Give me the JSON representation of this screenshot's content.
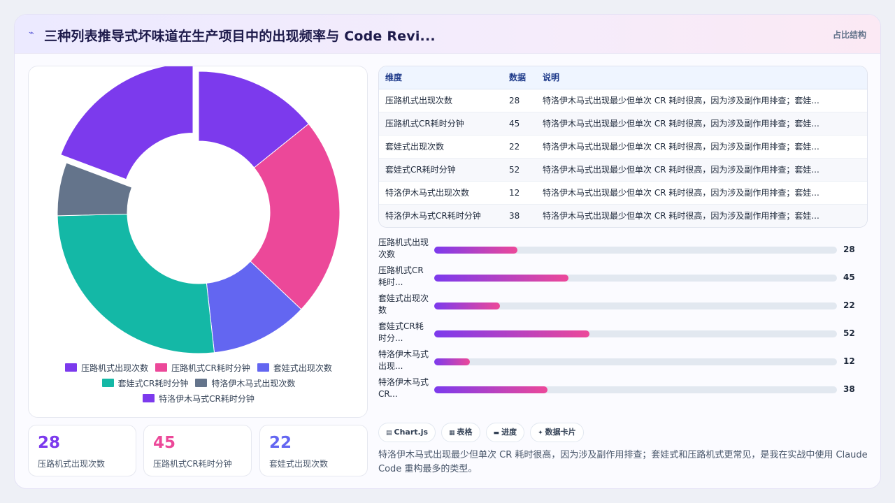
{
  "header": {
    "spark_icon": "sparkle-icon",
    "title": "三种列表推导式坏味道在生产项目中的出现频率与 Code Revi...",
    "tag": "占比结构"
  },
  "colors": {
    "palette": [
      "#7c3aed",
      "#ec4899",
      "#6366f1",
      "#14b8a6",
      "#64748b",
      "#7c3aed"
    ],
    "stat_colors": [
      "#7c3aed",
      "#ec4899",
      "#6366f1"
    ]
  },
  "chart_data": {
    "type": "pie",
    "variant": "doughnut",
    "categories": [
      "压路机式出现次数",
      "压路机式CR耗时分钟",
      "套娃式出现次数",
      "套娃式CR耗时分钟",
      "特洛伊木马式出现次数",
      "特洛伊木马式CR耗时分钟"
    ],
    "values": [
      28,
      45,
      22,
      52,
      12,
      38
    ],
    "exploded": "特洛伊木马式CR耗时分钟",
    "legend_position": "bottom"
  },
  "legend": [
    {
      "label": "压路机式出现次数",
      "color": "#7c3aed"
    },
    {
      "label": "压路机式CR耗时分钟",
      "color": "#ec4899"
    },
    {
      "label": "套娃式出现次数",
      "color": "#6366f1"
    },
    {
      "label": "套娃式CR耗时分钟",
      "color": "#14b8a6"
    },
    {
      "label": "特洛伊木马式出现次数",
      "color": "#64748b"
    },
    {
      "label": "特洛伊木马式CR耗时分钟",
      "color": "#7c3aed"
    }
  ],
  "stats": [
    {
      "value": "28",
      "label": "压路机式出现次数"
    },
    {
      "value": "45",
      "label": "压路机式CR耗时分钟"
    },
    {
      "value": "22",
      "label": "套娃式出现次数"
    }
  ],
  "table": {
    "headers": [
      "维度",
      "数据",
      "说明"
    ],
    "rows": [
      [
        "压路机式出现次数",
        "28",
        "特洛伊木马式出现最少但单次 CR 耗时很高，因为涉及副作用排查；套娃..."
      ],
      [
        "压路机式CR耗时分钟",
        "45",
        "特洛伊木马式出现最少但单次 CR 耗时很高，因为涉及副作用排查；套娃..."
      ],
      [
        "套娃式出现次数",
        "22",
        "特洛伊木马式出现最少但单次 CR 耗时很高，因为涉及副作用排查；套娃..."
      ],
      [
        "套娃式CR耗时分钟",
        "52",
        "特洛伊木马式出现最少但单次 CR 耗时很高，因为涉及副作用排查；套娃..."
      ],
      [
        "特洛伊木马式出现次数",
        "12",
        "特洛伊木马式出现最少但单次 CR 耗时很高，因为涉及副作用排查；套娃..."
      ],
      [
        "特洛伊木马式CR耗时分钟",
        "38",
        "特洛伊木马式出现最少但单次 CR 耗时很高，因为涉及副作用排查；套娃..."
      ]
    ]
  },
  "progress": {
    "max": 135,
    "items": [
      {
        "label": "压路机式出现次数",
        "value": 28
      },
      {
        "label": "压路机式CR耗时...",
        "value": 45
      },
      {
        "label": "套娃式出现次数",
        "value": 22
      },
      {
        "label": "套娃式CR耗时分...",
        "value": 52
      },
      {
        "label": "特洛伊木马式出现...",
        "value": 12
      },
      {
        "label": "特洛伊木马式CR...",
        "value": 38
      }
    ]
  },
  "chips": [
    {
      "icon": "chart-icon",
      "glyph": "▤",
      "label": "Chart.js"
    },
    {
      "icon": "table-icon",
      "glyph": "▦",
      "label": "表格"
    },
    {
      "icon": "progress-icon",
      "glyph": "▬",
      "label": "进度"
    },
    {
      "icon": "card-icon",
      "glyph": "✦",
      "label": "数据卡片"
    }
  ],
  "summary": "特洛伊木马式出现最少但单次 CR 耗时很高，因为涉及副作用排查；套娃式和压路机式更常见，是我在实战中使用 Claude Code 重构最多的类型。"
}
